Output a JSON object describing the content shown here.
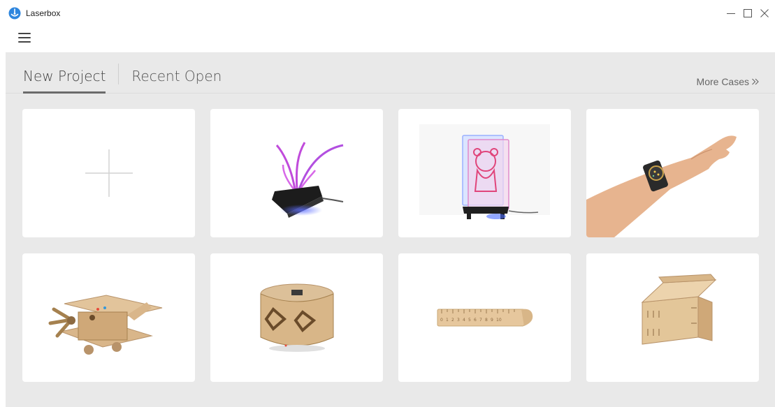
{
  "app": {
    "title": "Laserbox"
  },
  "window_controls": {
    "minimize": "minimize-icon",
    "maximize": "maximize-icon",
    "close": "close-icon"
  },
  "menu": {
    "icon": "hamburger-icon"
  },
  "tabs": [
    {
      "label": "New Project",
      "active": true
    },
    {
      "label": "Recent Open",
      "active": false
    }
  ],
  "more_cases": {
    "label": "More Cases",
    "icon": "double-chevron-right-icon"
  },
  "cards": [
    {
      "type": "new",
      "icon": "plus-icon"
    },
    {
      "type": "case",
      "icon": "acrylic-lamp-image"
    },
    {
      "type": "case",
      "icon": "bear-acrylic-lamp-image"
    },
    {
      "type": "case",
      "icon": "wrist-watch-image"
    },
    {
      "type": "case",
      "icon": "wooden-airplane-image"
    },
    {
      "type": "case",
      "icon": "wooden-speaker-box-image"
    },
    {
      "type": "case",
      "icon": "wooden-ruler-image"
    },
    {
      "type": "case",
      "icon": "wooden-box-image"
    }
  ],
  "colors": {
    "accent_underline": "#6b6b6b",
    "background": "#e9e9e9",
    "card": "#ffffff"
  }
}
